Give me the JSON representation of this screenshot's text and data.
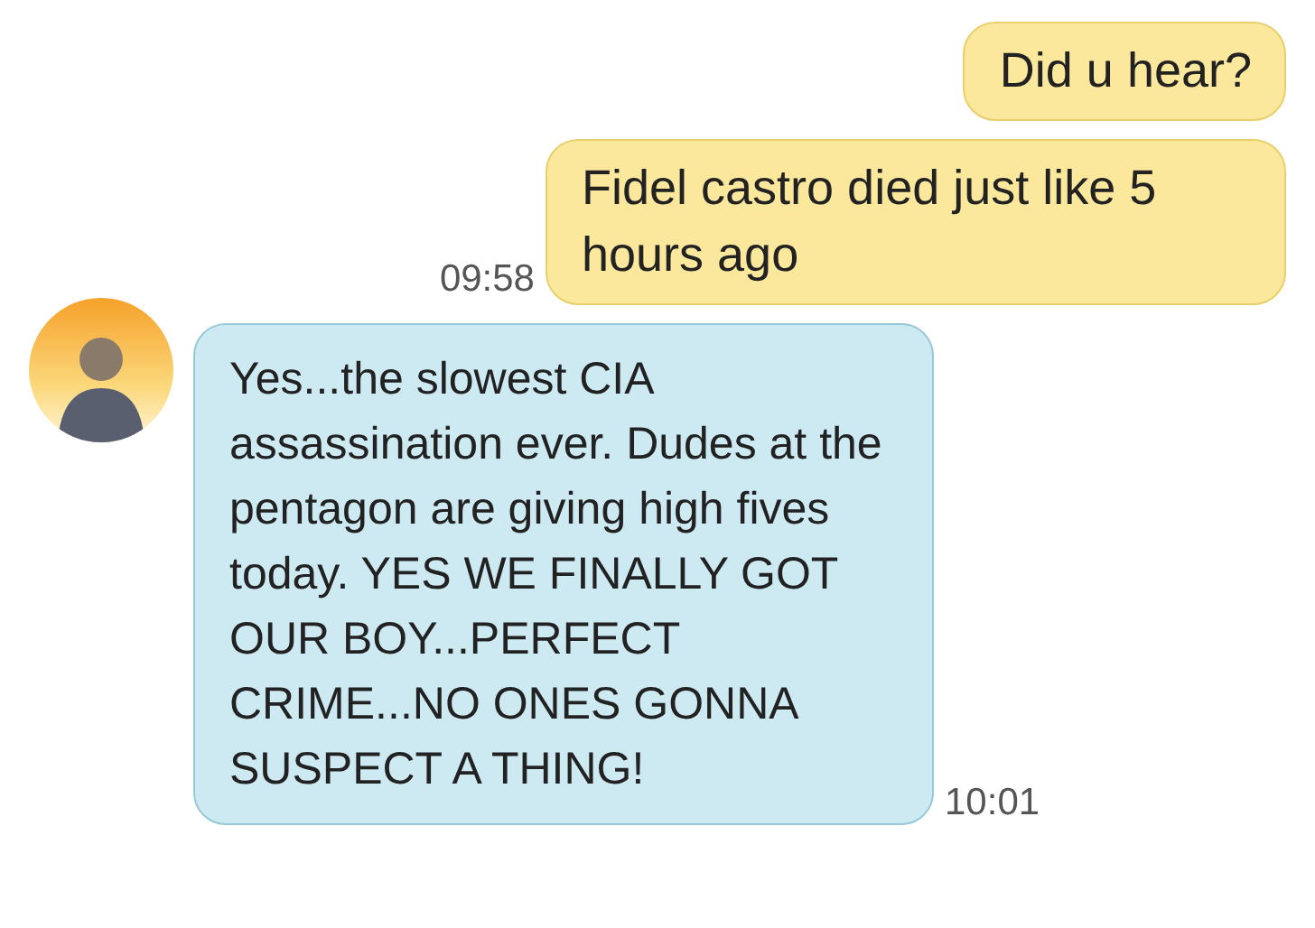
{
  "messages": [
    {
      "kind": "outgoing",
      "text": "Did u hear?"
    },
    {
      "kind": "outgoing",
      "text": "Fidel castro died just like 5 hours ago",
      "time": "09:58"
    },
    {
      "kind": "incoming",
      "text": "Yes...the slowest CIA assassination ever. Dudes at the pentagon are giving high fives today. YES WE FINALLY GOT OUR BOY...PERFECT CRIME...NO ONES GONNA SUSPECT A THING!",
      "time": "10:01"
    }
  ]
}
